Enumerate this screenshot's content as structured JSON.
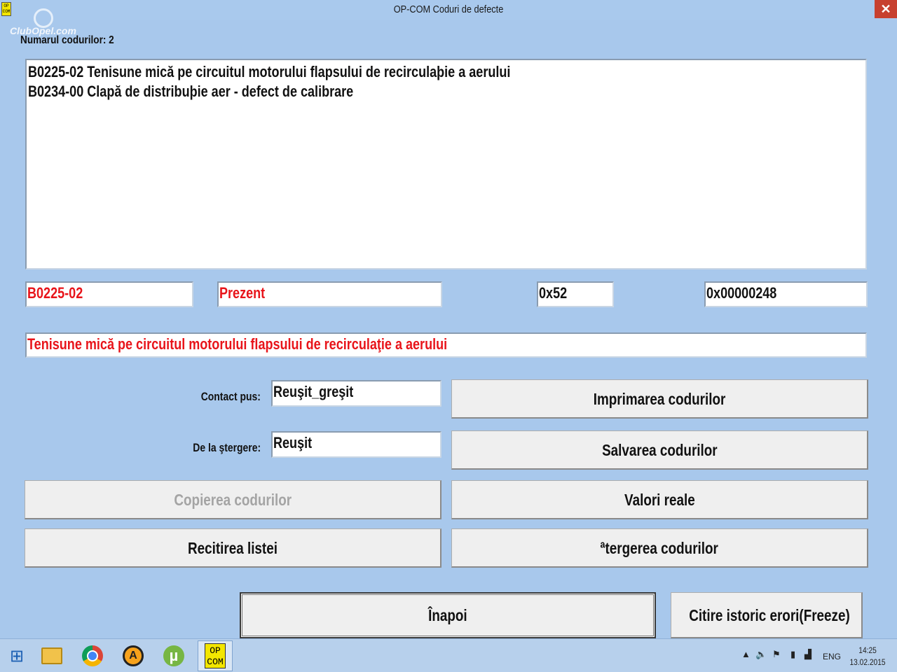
{
  "window": {
    "icon_text_top": "OP",
    "icon_text_bottom": "COM",
    "title": "OP-COM   Coduri de defecte",
    "close_glyph": "✕"
  },
  "watermark": "ClubOpel.com",
  "count_label": "Numarul codurilor: 2",
  "codes": [
    "B0225-02 Tenisune mică pe circuitul motorului flapsului de recirculaþie a aerului",
    "B0234-00 Clapă de distribuþie aer - defect de calibrare"
  ],
  "detail": {
    "code": "B0225-02",
    "status": "Prezent",
    "hex1": "0x52",
    "hex2": "0x00000248",
    "description": "Tenisune mică pe circuitul motorului flapsului de recirculaţie a aerului"
  },
  "readiness": {
    "contact_label": "Contact pus:",
    "contact_value": "Reuşit_greşit",
    "erase_label": "De la ştergere:",
    "erase_value": "Reuşit"
  },
  "buttons": {
    "print": "Imprimarea codurilor",
    "save": "Salvarea codurilor",
    "copy": "Copierea codurilor",
    "live": "Valori reale",
    "reread": "Recitirea listei",
    "clear": "ªtergerea codurilor",
    "back": "Înapoi",
    "freeze": "Citire istoric erori(Freeze)"
  },
  "taskbar": {
    "start_icon": "⊞",
    "opcom_top": "OP",
    "opcom_bottom": "COM",
    "aimp_glyph": "A",
    "utorrent_glyph": "µ",
    "tray_up": "▲",
    "tray_volume": "🔈",
    "tray_flag": "⚑",
    "tray_battery": "▮",
    "tray_network": "▟",
    "language": "ENG",
    "time": "14:25",
    "date": "13.02.2015"
  },
  "colors": {
    "background": "#a8c8ec",
    "error_text": "#e8141a",
    "close_button": "#c7402f"
  }
}
